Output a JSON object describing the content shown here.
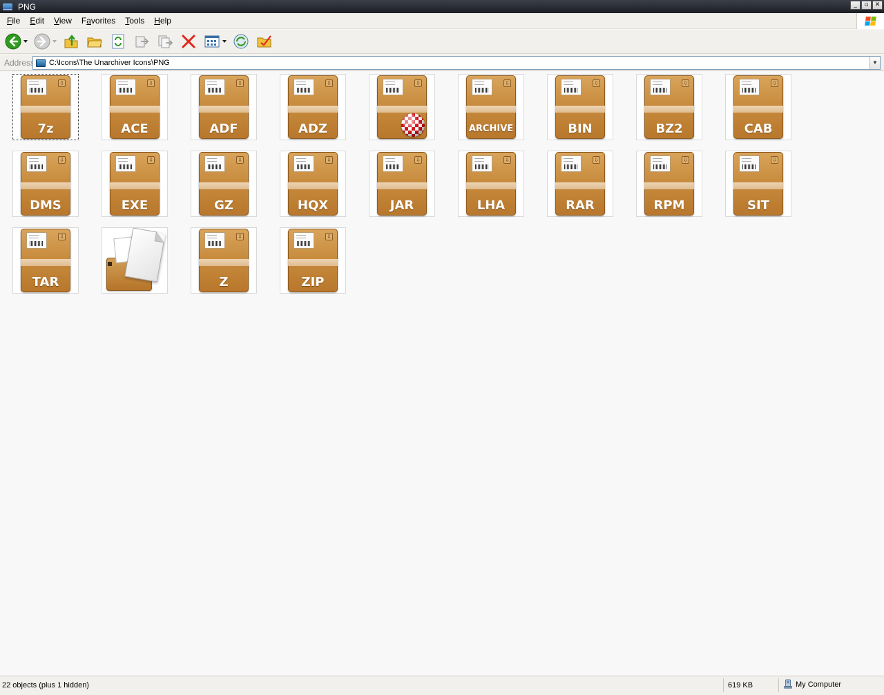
{
  "window": {
    "title": "PNG"
  },
  "titlebar_buttons": [
    "_",
    "▫",
    "✕"
  ],
  "menu": [
    {
      "label": "File",
      "accel": "F",
      "rest": "ile"
    },
    {
      "label": "Edit",
      "accel": "E",
      "rest": "dit"
    },
    {
      "label": "View",
      "accel": "V",
      "rest": "iew"
    },
    {
      "label": "Favorites",
      "accel": "a",
      "pre": "F",
      "rest": "vorites"
    },
    {
      "label": "Tools",
      "accel": "T",
      "rest": "ools"
    },
    {
      "label": "Help",
      "accel": "H",
      "rest": "elp"
    }
  ],
  "toolbar": {
    "items": [
      "back-icon",
      "forward-icon",
      "up-folder-icon",
      "folders-icon",
      "refresh-icon",
      "move-to-icon",
      "copy-to-icon",
      "delete-icon",
      "views-icon",
      "sync-icon",
      "favorites-icon"
    ],
    "colors": {
      "back": "#2f9b1f",
      "delete": "#e0281c",
      "folder": "#f2c33b"
    }
  },
  "address": {
    "label": "Address",
    "path": "C:\\Icons\\The Unarchiver Icons\\PNG"
  },
  "files": [
    {
      "ext": "7z"
    },
    {
      "ext": "ACE"
    },
    {
      "ext": "ADF"
    },
    {
      "ext": "ADZ"
    },
    {
      "ext": "",
      "variant": "amiga-ball"
    },
    {
      "ext": "ARCHIVE"
    },
    {
      "ext": "BIN"
    },
    {
      "ext": "BZ2"
    },
    {
      "ext": "CAB"
    },
    {
      "ext": "DMS"
    },
    {
      "ext": "EXE"
    },
    {
      "ext": "GZ"
    },
    {
      "ext": "HQX"
    },
    {
      "ext": "JAR"
    },
    {
      "ext": "LHA"
    },
    {
      "ext": "RAR"
    },
    {
      "ext": "RPM"
    },
    {
      "ext": "SIT"
    },
    {
      "ext": "TAR"
    },
    {
      "ext": "",
      "variant": "open-box"
    },
    {
      "ext": "Z"
    },
    {
      "ext": "ZIP"
    }
  ],
  "status": {
    "objects": "22 objects (plus 1 hidden)",
    "size": "619 KB",
    "zone": "My Computer"
  }
}
